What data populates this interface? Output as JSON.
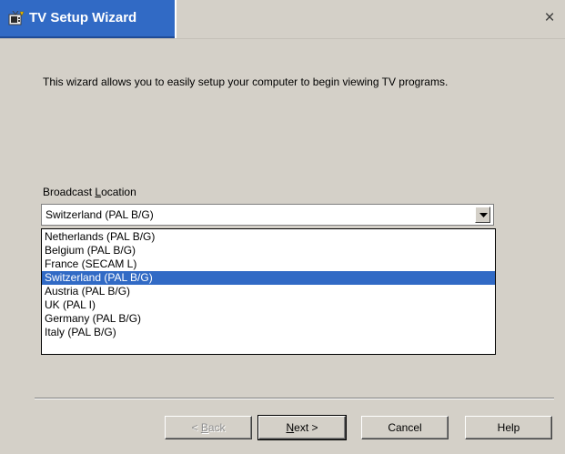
{
  "window": {
    "title": "TV Setup Wizard",
    "close_glyph": "×",
    "icon": "tv-wizard-icon"
  },
  "intro_text": "This wizard allows you to easily setup your computer to begin viewing TV programs.",
  "broadcast_location": {
    "label_prefix": "Broadcast ",
    "label_accel": "L",
    "label_suffix": "ocation",
    "selected_value": "Switzerland (PAL B/G)",
    "options": [
      "Netherlands (PAL B/G)",
      "Belgium (PAL B/G)",
      "France (SECAM L)",
      "Switzerland (PAL B/G)",
      "Austria (PAL B/G)",
      "UK (PAL I)",
      "Germany (PAL B/G)",
      "Italy (PAL B/G)"
    ],
    "highlighted_index": 3
  },
  "buttons": {
    "back": {
      "prefix": "< ",
      "accel": "B",
      "suffix": "ack",
      "enabled": false
    },
    "next": {
      "prefix": "",
      "accel": "N",
      "suffix": "ext >",
      "enabled": true
    },
    "cancel": {
      "label": "Cancel"
    },
    "help": {
      "label": "Help"
    }
  },
  "colors": {
    "face": "#d4d0c8",
    "title_accent": "#316ac5",
    "selection": "#316ac5"
  }
}
